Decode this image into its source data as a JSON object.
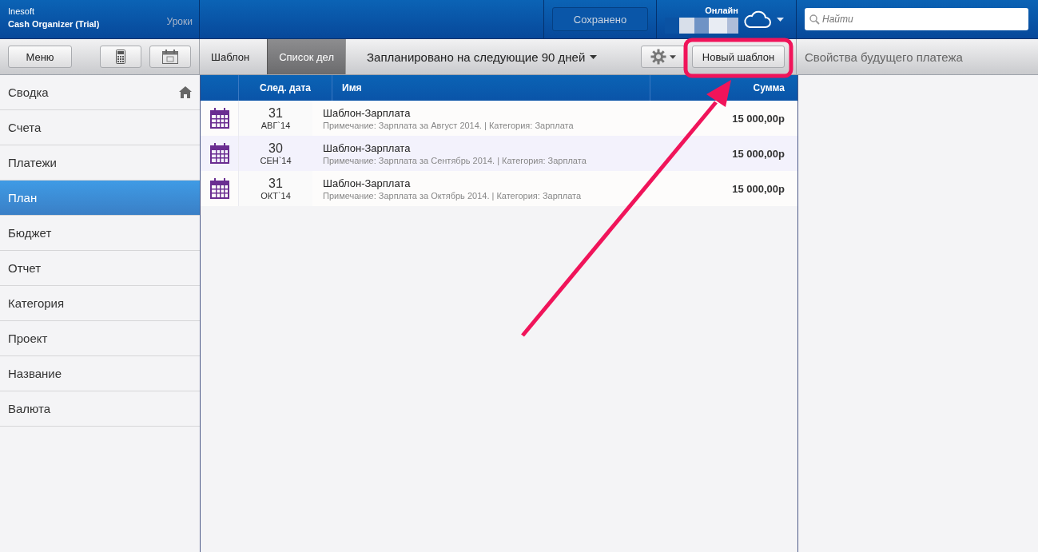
{
  "app": {
    "vendor": "Inesoft",
    "product": "Cash Organizer (Trial)",
    "lessons_link": "Уроки"
  },
  "saved_button": "Сохранено",
  "online": {
    "label": "Онлайн"
  },
  "search": {
    "placeholder": "Найти"
  },
  "toolbar": {
    "menu_button": "Меню"
  },
  "tabs": [
    {
      "label": "Шаблон",
      "selected": false
    },
    {
      "label": "Список дел",
      "selected": true
    }
  ],
  "period_dropdown": "Запланировано на следующие 90 дней",
  "new_template_button": "Новый шаблон",
  "details_panel": {
    "title": "Свойства будущего платежа"
  },
  "sidebar": {
    "items": [
      {
        "label": "Сводка",
        "selected": false,
        "kind": "home"
      },
      {
        "label": "Счета",
        "selected": false,
        "kind": "plain"
      },
      {
        "label": "Платежи",
        "selected": false,
        "kind": "plain"
      },
      {
        "label": "План",
        "selected": true,
        "kind": "plain"
      },
      {
        "label": "Бюджет",
        "selected": false,
        "kind": "plain"
      },
      {
        "label": "Отчет",
        "selected": false,
        "kind": "plain"
      },
      {
        "label": "Категория",
        "selected": false,
        "kind": "plain"
      },
      {
        "label": "Проект",
        "selected": false,
        "kind": "plain"
      },
      {
        "label": "Название",
        "selected": false,
        "kind": "plain"
      },
      {
        "label": "Валюта",
        "selected": false,
        "kind": "plain"
      }
    ]
  },
  "table": {
    "columns": [
      "След. дата",
      "Имя",
      "Сумма"
    ],
    "rows": [
      {
        "day": "31",
        "month": "АВГ`14",
        "name": "Шаблон-Зарплата",
        "note": "Примечание: Зарплата за Август 2014. | Категория: Зарплата",
        "amount": "15 000,00р"
      },
      {
        "day": "30",
        "month": "СЕН`14",
        "name": "Шаблон-Зарплата",
        "note": "Примечание: Зарплата за Сентябрь 2014. | Категория: Зарплата",
        "amount": "15 000,00р"
      },
      {
        "day": "31",
        "month": "ОКТ`14",
        "name": "Шаблон-Зарплата",
        "note": "Примечание: Зарплата за Октябрь 2014. | Категория: Зарплата",
        "amount": "15 000,00р"
      }
    ]
  }
}
